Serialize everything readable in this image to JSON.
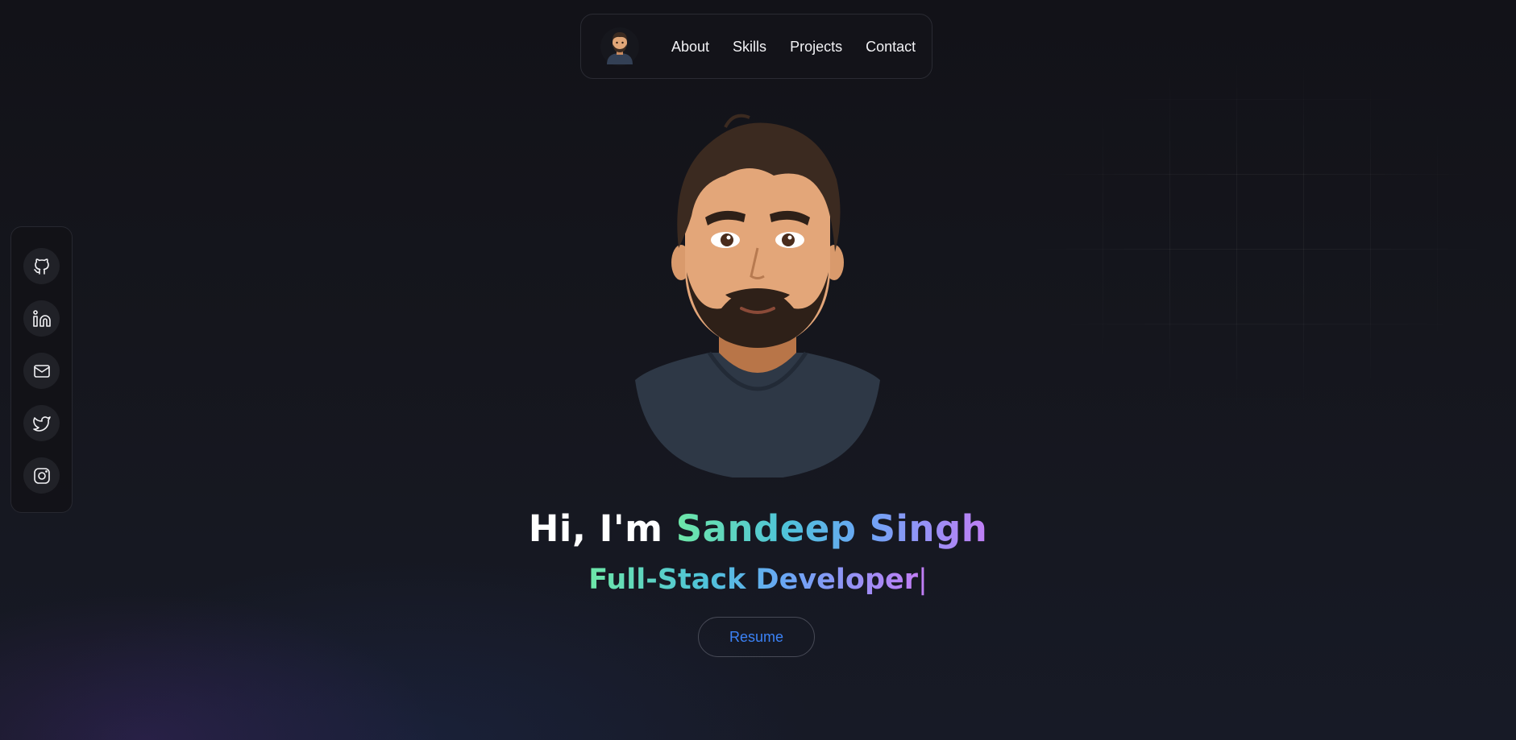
{
  "nav": {
    "avatar_icon": "developer-avatar",
    "links": [
      "About",
      "Skills",
      "Projects",
      "Contact"
    ]
  },
  "social": {
    "icons": [
      "github-icon",
      "linkedin-icon",
      "mail-icon",
      "twitter-icon",
      "instagram-icon"
    ]
  },
  "hero": {
    "greeting": "Hi, I'm",
    "name": "Sandeep Singh",
    "role": "Full-Stack Developer",
    "cursor": "|",
    "resume_label": "Resume"
  },
  "colors": {
    "background": "#15161d",
    "accent_blue": "#3b82f6",
    "gradient_start": "#6ee7a8",
    "gradient_mid": "#6aa6f5",
    "gradient_end": "#c07ef5"
  }
}
